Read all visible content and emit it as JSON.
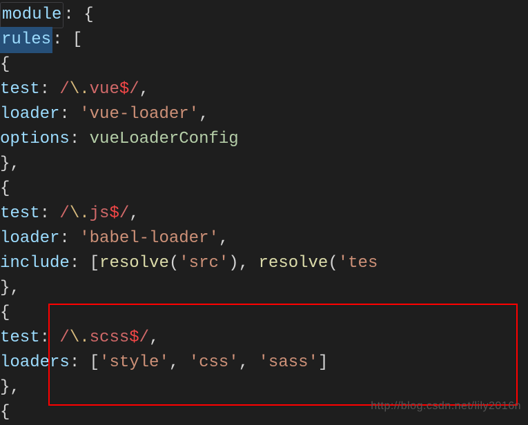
{
  "code": {
    "l1_module": "module",
    "l1_punct": ": {",
    "l2_rules": "rules",
    "l2_punct": ": [",
    "l3_brace": "{",
    "l4_test": "test",
    "l4_colon": ": ",
    "l4_regex_open": "/",
    "l4_regex_esc": "\\.",
    "l4_regex_body": "vue",
    "l4_regex_anchor": "$",
    "l4_regex_close": "/",
    "l4_comma": ",",
    "l5_loader": "loader",
    "l5_colon": ": ",
    "l5_str": "'vue-loader'",
    "l5_comma": ",",
    "l6_options": "options",
    "l6_colon": ": ",
    "l6_var": "vueLoaderConfig",
    "l7_close": "},",
    "l8_brace": "{",
    "l9_test": "test",
    "l9_colon": ": ",
    "l9_regex_open": "/",
    "l9_regex_esc": "\\.",
    "l9_regex_body": "js",
    "l9_regex_anchor": "$",
    "l9_regex_close": "/",
    "l9_comma": ",",
    "l10_loader": "loader",
    "l10_colon": ": ",
    "l10_str": "'babel-loader'",
    "l10_comma": ",",
    "l11_include": "include",
    "l11_colon": ": [",
    "l11_resolve1": "resolve",
    "l11_paren1_open": "(",
    "l11_arg1": "'src'",
    "l11_paren1_close": ")",
    "l11_mid": ", ",
    "l11_resolve2": "resolve",
    "l11_paren2_open": "(",
    "l11_arg2": "'tes",
    "l12_close": "},",
    "l13_brace": "{",
    "l14_test": "test",
    "l14_colon": ": ",
    "l14_regex_open": "/",
    "l14_regex_esc": "\\.",
    "l14_regex_body": "scss",
    "l14_regex_anchor": "$",
    "l14_regex_close": "/",
    "l14_comma": ",",
    "l15_loaders": "loaders",
    "l15_colon": ": [",
    "l15_s1": "'style'",
    "l15_c1": ", ",
    "l15_s2": "'css'",
    "l15_c2": ", ",
    "l15_s3": "'sass'",
    "l15_close": "]",
    "l16_close": "},",
    "l17_brace": "{"
  },
  "watermark": "http://blog.csdn.net/lily2016n"
}
